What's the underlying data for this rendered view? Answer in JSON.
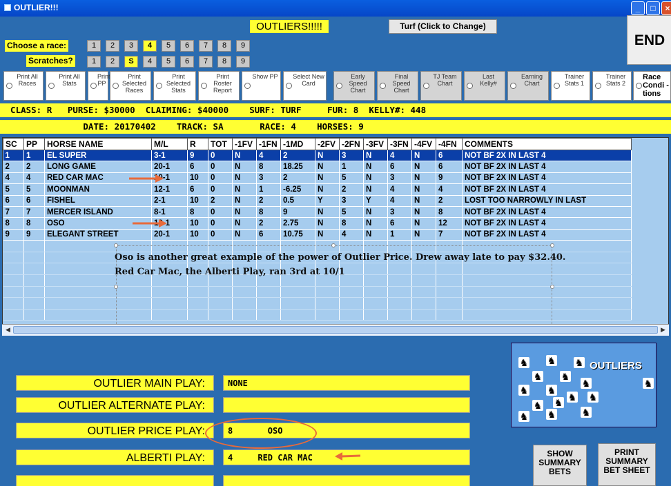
{
  "window": {
    "title": "OUTLIER!!!"
  },
  "header": {
    "headline": "OUTLIERS!!!!!",
    "turf_button": "Turf (Click to Change)",
    "end_button": "END",
    "choose_race_label": "Choose  a race:",
    "scratches_label": "Scratches?",
    "race_numbers": [
      "1",
      "2",
      "3",
      "4",
      "5",
      "6",
      "7",
      "8",
      "9"
    ],
    "race_selected": "4",
    "scratch_numbers": [
      "1",
      "2",
      "S",
      "4",
      "5",
      "6",
      "7",
      "8",
      "9"
    ],
    "scratch_selected": "S"
  },
  "options": [
    "Print All Races",
    "Print All Stats",
    "Print PP",
    "Print Selected Races",
    "Print Selected Stats",
    "Print Roster Report",
    "Show PP",
    "Select New Card",
    "Early Speed Chart",
    "Final Speed Chart",
    "TJ Team Chart",
    "Last Kelly#",
    "Earning Chart",
    "Trainer Stats 1",
    "Trainer Stats 2",
    "Race Condi -tions"
  ],
  "info": {
    "line1": "  CLASS: R   PURSE: $30000  CLAIMING: $40000    SURF: TURF     FUR: 8  KELLY#: 448",
    "line2": "                DATE: 20170402    TRACK: SA       RACE: 4    HORSES: 9"
  },
  "table": {
    "headers": [
      "SC",
      "PP",
      "HORSE NAME",
      "M/L",
      "R",
      "TOT",
      "-1FV",
      "-1FN",
      "-1MD",
      "-2FV",
      "-2FN",
      "-3FV",
      "-3FN",
      "-4FV",
      "-4FN",
      "COMMENTS"
    ],
    "rows": [
      [
        "1",
        "1",
        "EL SUPER",
        "3-1",
        "9",
        "0",
        "N",
        "4",
        "2",
        "N",
        "3",
        "N",
        "4",
        "N",
        "6",
        "NOT BF 2X IN LAST 4"
      ],
      [
        "2",
        "2",
        "LONG GAME",
        "20-1",
        "6",
        "0",
        "N",
        "8",
        "18.25",
        "N",
        "1",
        "N",
        "6",
        "N",
        "6",
        "NOT BF 2X IN LAST 4"
      ],
      [
        "4",
        "4",
        "RED CAR MAC",
        "10-1",
        "10",
        "0",
        "N",
        "3",
        "2",
        "N",
        "5",
        "N",
        "3",
        "N",
        "9",
        "NOT BF 2X IN LAST 4"
      ],
      [
        "5",
        "5",
        "MOONMAN",
        "12-1",
        "6",
        "0",
        "N",
        "1",
        "-6.25",
        "N",
        "2",
        "N",
        "4",
        "N",
        "4",
        "NOT BF 2X IN LAST 4"
      ],
      [
        "6",
        "6",
        "FISHEL",
        "2-1",
        "10",
        "2",
        "N",
        "2",
        "0.5",
        "Y",
        "3",
        "Y",
        "4",
        "N",
        "2",
        "LOST TOO NARROWLY IN LAST"
      ],
      [
        "7",
        "7",
        "MERCER ISLAND",
        "8-1",
        "8",
        "0",
        "N",
        "8",
        "9",
        "N",
        "5",
        "N",
        "3",
        "N",
        "8",
        "NOT BF 2X IN LAST 4"
      ],
      [
        "8",
        "8",
        "OSO",
        "12-1",
        "10",
        "0",
        "N",
        "2",
        "2.75",
        "N",
        "8",
        "N",
        "6",
        "N",
        "12",
        "NOT BF 2X IN LAST 4"
      ],
      [
        "9",
        "9",
        "ELEGANT STREET",
        "20-1",
        "10",
        "0",
        "N",
        "6",
        "10.75",
        "N",
        "4",
        "N",
        "1",
        "N",
        "7",
        "NOT BF 2X IN LAST 4"
      ]
    ]
  },
  "annotation": {
    "line1": "Oso is another great example of the power of Outlier Price.  Drew away late to pay $32.40.",
    "line2": "Red Car Mac, the Alberti Play, ran 3rd at 10/1"
  },
  "plays": [
    {
      "label": "OUTLIER MAIN PLAY:",
      "value": "NONE"
    },
    {
      "label": "OUTLIER ALTERNATE PLAY:",
      "value": ""
    },
    {
      "label": "OUTLIER PRICE PLAY:",
      "value": "8       OSO"
    },
    {
      "label": "ALBERTI PLAY:",
      "value": "4     RED CAR MAC"
    },
    {
      "label": "",
      "value": ""
    }
  ],
  "logo": {
    "text": "OUTLIERS"
  },
  "bottom_buttons": {
    "show_summary": "SHOW SUMMARY BETS",
    "print_summary": "PRINT SUMMARY BET SHEET"
  },
  "colors": {
    "background": "#2b6cb0",
    "yellow": "#ffff33",
    "selected_row": "#0b3fa8",
    "grid": "#a6ccee",
    "arrow": "#e86a3a"
  },
  "icons": {
    "horse": "horse-head-icon",
    "arrow": "red-arrow-icon"
  }
}
